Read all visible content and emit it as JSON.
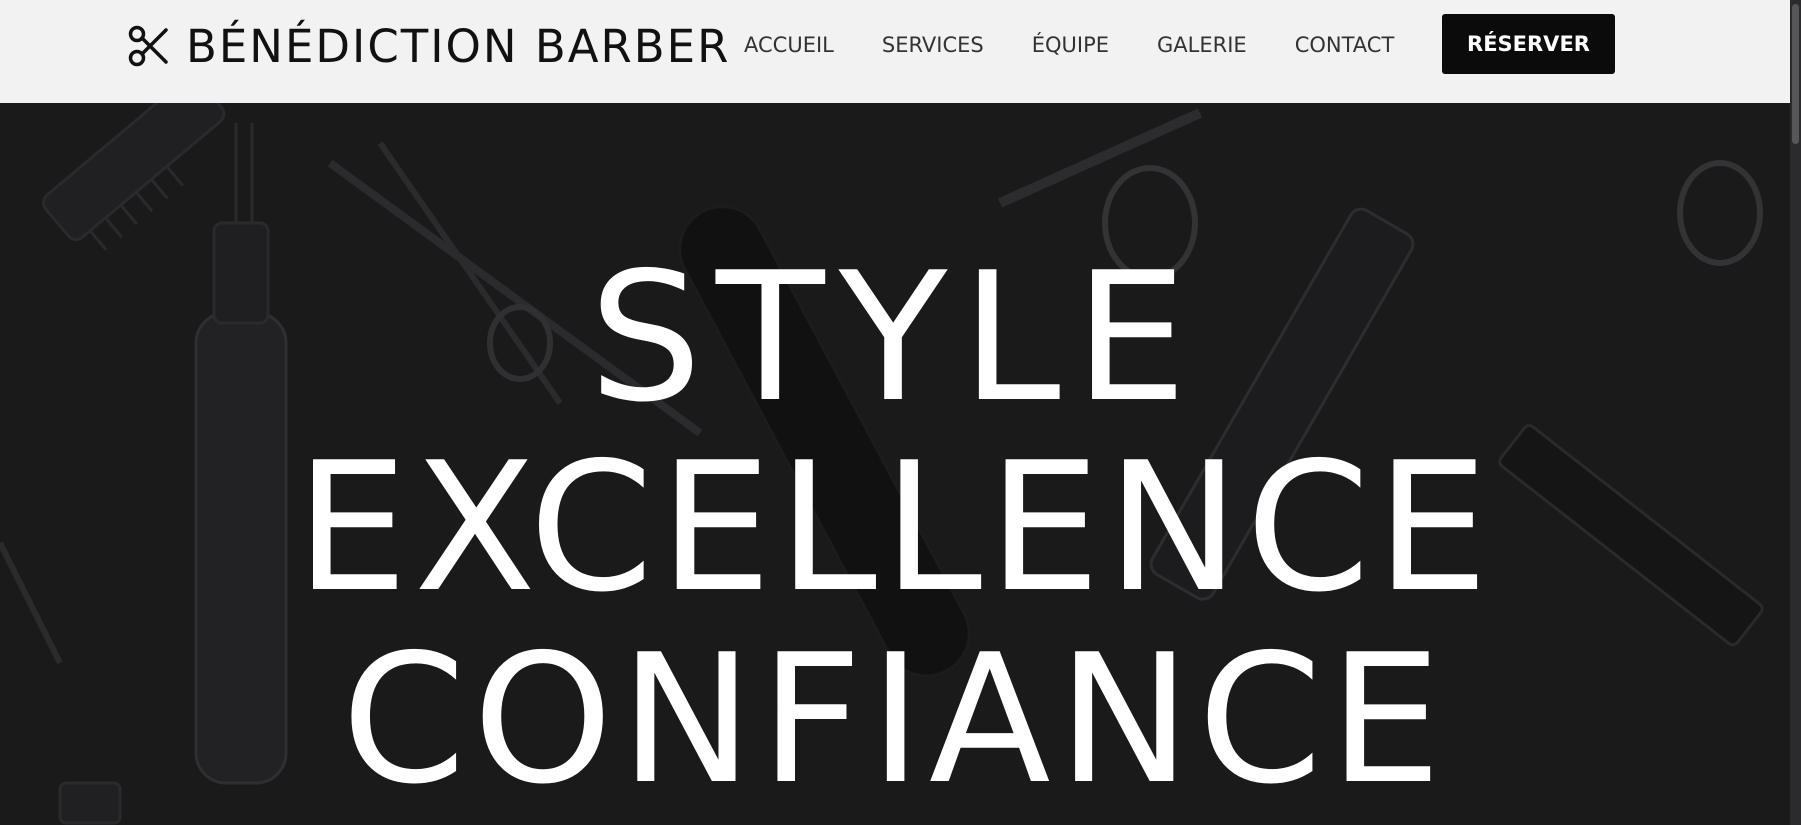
{
  "header": {
    "brand_name": "BÉNÉDICTION BARBER",
    "logo_icon": "scissors-icon",
    "nav": [
      {
        "label": "ACCUEIL"
      },
      {
        "label": "SERVICES"
      },
      {
        "label": "ÉQUIPE"
      },
      {
        "label": "GALERIE"
      },
      {
        "label": "CONTACT"
      }
    ],
    "cta_label": "RÉSERVER"
  },
  "hero": {
    "lines": [
      "STYLE",
      "EXCELLENCE",
      "CONFIANCE"
    ],
    "background": "barber-tools-pattern"
  },
  "colors": {
    "header_bg": "#f2f2f2",
    "hero_bg": "#1a1a1b",
    "cta_bg": "#0b0b0b",
    "hero_text": "#ffffff"
  }
}
